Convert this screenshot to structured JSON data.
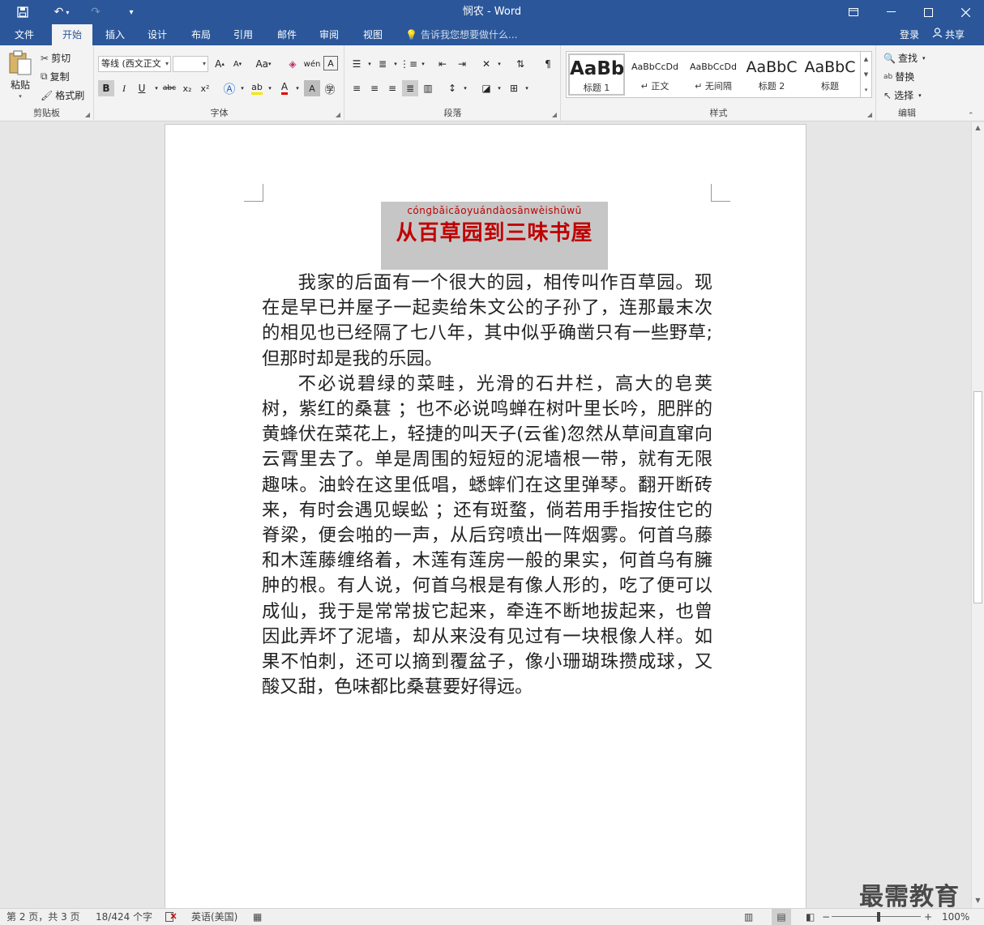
{
  "window": {
    "title": "悯农 - Word"
  },
  "quick_access": {
    "save": "💾",
    "undo": "↶",
    "redo": "↷",
    "customize": "▾"
  },
  "tabs": [
    "文件",
    "开始",
    "插入",
    "设计",
    "布局",
    "引用",
    "邮件",
    "审阅",
    "视图"
  ],
  "tell_me": "告诉我您想要做什么...",
  "account": {
    "login": "登录",
    "share": "共享"
  },
  "clipboard": {
    "paste": "粘贴",
    "cut": "剪切",
    "copy": "复制",
    "format_painter": "格式刷",
    "label": "剪贴板"
  },
  "font": {
    "name": "等线 (西文正文",
    "size": "",
    "grow": "A",
    "shrink": "A",
    "case": "Aa",
    "bold": "B",
    "italic": "I",
    "underline": "U",
    "strike": "abc",
    "sub": "x₂",
    "sup": "x²",
    "label": "字体"
  },
  "paragraph": {
    "label": "段落"
  },
  "styles": {
    "items": [
      {
        "sample": "AaBb",
        "name": "标题 1"
      },
      {
        "sample": "AaBbCcDd",
        "name": "↵ 正文"
      },
      {
        "sample": "AaBbCcDd",
        "name": "↵ 无间隔"
      },
      {
        "sample": "AaBbC",
        "name": "标题 2"
      },
      {
        "sample": "AaBbC",
        "name": "标题"
      }
    ],
    "label": "样式"
  },
  "editing": {
    "find": "查找",
    "replace": "替换",
    "select": "选择",
    "label": "编辑"
  },
  "document": {
    "pinyin": "cónɡbǎicǎoyuándàosānwèishūwū",
    "title": "从百草园到三味书屋",
    "paragraphs": [
      "我家的后面有一个很大的园，相传叫作百草园。现在是早已并屋子一起卖给朱文公的子孙了，连那最末次的相见也已经隔了七八年，其中似乎确凿只有一些野草;但那时却是我的乐园。",
      "不必说碧绿的菜畦，光滑的石井栏，高大的皂荚树，紫红的桑葚 ；也不必说鸣蝉在树叶里长吟，肥胖的黄蜂伏在菜花上，轻捷的叫天子(云雀)忽然从草间直窜向云霄里去了。单是周围的短短的泥墙根一带，就有无限趣味。油蛉在这里低唱，蟋蟀们在这里弹琴。翻开断砖来，有时会遇见蜈蚣 ；还有斑蝥，倘若用手指按住它的脊梁，便会啪的一声，从后窍喷出一阵烟雾。何首乌藤和木莲藤缠络着，木莲有莲房一般的果实，何首乌有臃肿的根。有人说，何首乌根是有像人形的，吃了便可以成仙，我于是常常拔它起来，牵连不断地拔起来，也曾因此弄坏了泥墙，却从来没有见过有一块根像人样。如果不怕刺，还可以摘到覆盆子，像小珊瑚珠攒成球，又酸又甜，色味都比桑葚要好得远。"
    ]
  },
  "status": {
    "page": "第 2 页，共 3 页",
    "words": "18/424 个字",
    "language": "英语(美国)",
    "zoom": "100%",
    "zoom_minus": "−",
    "zoom_plus": "+"
  },
  "watermark": "最需教育",
  "colors": {
    "accent": "#2b579a",
    "title_red": "#c00000",
    "highlight": "#c6c6c6"
  }
}
